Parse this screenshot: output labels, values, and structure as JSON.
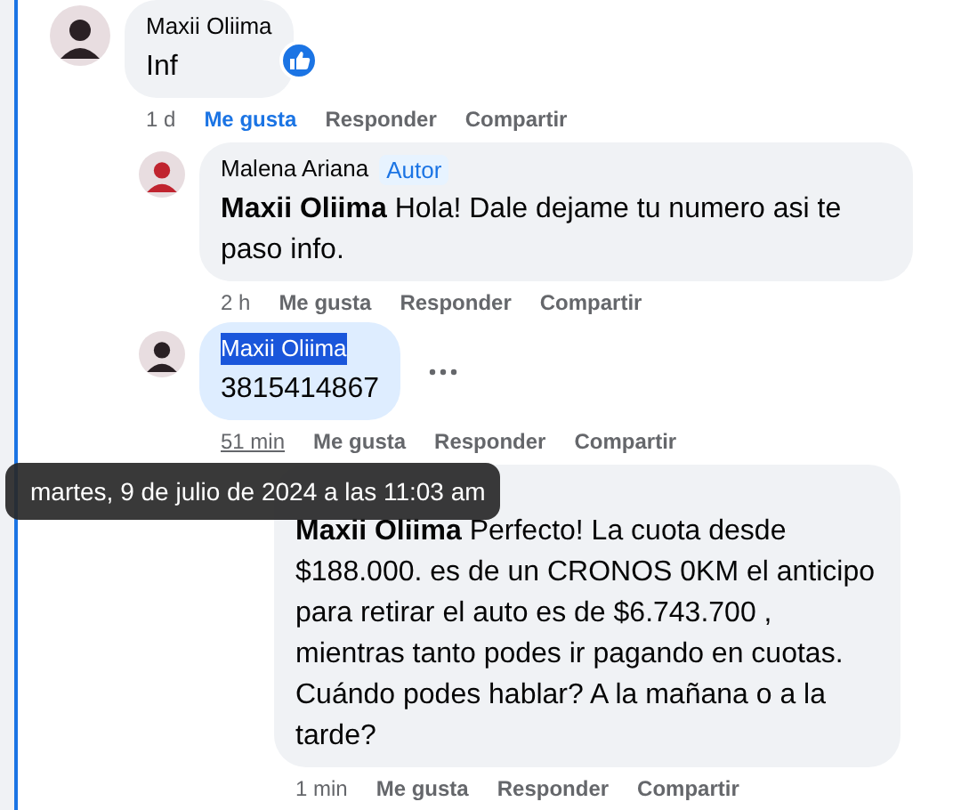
{
  "comments": [
    {
      "author": "Maxii Oliima",
      "color": "#2a2024",
      "text": "Inf",
      "highlighted": false,
      "name_selected": false,
      "has_reaction": true,
      "show_menu": false,
      "time": "1 d",
      "time_hovered": false,
      "liked": true,
      "actions": [
        "Me gusta",
        "Responder",
        "Compartir"
      ],
      "children": [
        {
          "author": "Malena Ariana",
          "color": "#c0242f",
          "badge": "Autor",
          "text": "**Maxii Oliima** Hola! Dale dejame tu numero asi te paso info.",
          "highlighted": false,
          "name_selected": false,
          "has_reaction": false,
          "show_menu": false,
          "time": "2 h",
          "time_hovered": false,
          "liked": false,
          "actions": [
            "Me gusta",
            "Responder",
            "Compartir"
          ]
        },
        {
          "author": "Maxii Oliima",
          "color": "#2a2024",
          "text": "3815414867",
          "highlighted": true,
          "name_selected": true,
          "has_reaction": false,
          "show_menu": true,
          "time": "51 min",
          "time_hovered": true,
          "liked": false,
          "actions": [
            "Me gusta",
            "Responder",
            "Compartir"
          ],
          "children": [
            {
              "text": "**Maxii Oliima** Perfecto! La cuota desde $188.000. es de un CRONOS 0KM el anticipo para retirar el auto es de $6.743.700 , mientras tanto podes ir pagando en cuotas. Cuándo podes hablar? A la mañana o a la tarde?",
              "highlighted": false,
              "has_reaction": false,
              "show_menu": false,
              "time": "1 min",
              "time_hovered": false,
              "liked": false,
              "actions": [
                "Me gusta",
                "Responder",
                "Compartir"
              ]
            }
          ]
        }
      ]
    }
  ],
  "tooltip": "martes, 9 de julio de 2024 a las 11:03 am"
}
